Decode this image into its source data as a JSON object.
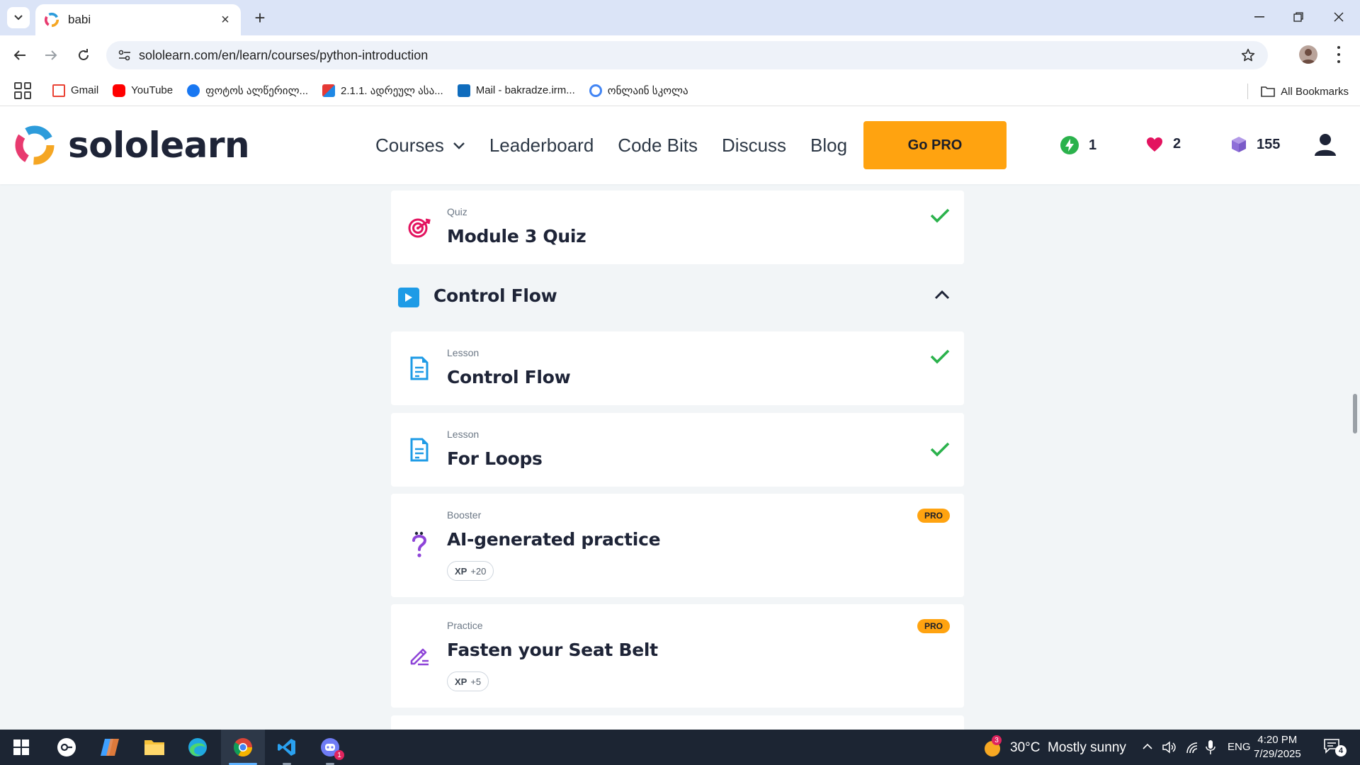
{
  "browser": {
    "tab_title": "babi",
    "url": "sololearn.com/en/learn/courses/python-introduction",
    "bookmarks": [
      {
        "label": "Gmail",
        "color": "#ea4335"
      },
      {
        "label": "YouTube",
        "color": "#ff0000"
      },
      {
        "label": "ფოტოს ალწერილ...",
        "color": "#1877f2"
      },
      {
        "label": "2.1.1. ადრეულ ასა...",
        "color": "#3b5bdb"
      },
      {
        "label": "Mail - bakradze.irm...",
        "color": "#0f6cbd"
      },
      {
        "label": "ონლაინ სკოლა",
        "color": "#4285f4"
      }
    ],
    "all_bookmarks": "All Bookmarks"
  },
  "site": {
    "logo_text": "sololearn",
    "nav": {
      "courses": "Courses",
      "leaderboard": "Leaderboard",
      "code_bits": "Code Bits",
      "discuss": "Discuss",
      "blog": "Blog"
    },
    "go_pro": "Go PRO",
    "stats": {
      "streak": "1",
      "hearts": "2",
      "bits": "155"
    },
    "accent": "#ffa310"
  },
  "content": {
    "quiz_card": {
      "kind": "Quiz",
      "title": "Module 3 Quiz",
      "completed": true
    },
    "section": {
      "title": "Control Flow",
      "expanded": true
    },
    "items": [
      {
        "kind": "Lesson",
        "title": "Control Flow",
        "completed": true
      },
      {
        "kind": "Lesson",
        "title": "For Loops",
        "completed": true
      },
      {
        "kind": "Booster",
        "title": "AI-generated practice",
        "badge": "PRO",
        "xp_label": "XP",
        "xp_value": "+20"
      },
      {
        "kind": "Practice",
        "title": "Fasten your Seat Belt",
        "badge": "PRO",
        "xp_label": "XP",
        "xp_value": "+5"
      }
    ]
  },
  "taskbar": {
    "weather_badge": "3",
    "weather": "30°C  Mostly sunny",
    "language": "ENG",
    "time": "4:20 PM",
    "date": "7/29/2025",
    "notifications": "4",
    "discord_badge": "1"
  }
}
